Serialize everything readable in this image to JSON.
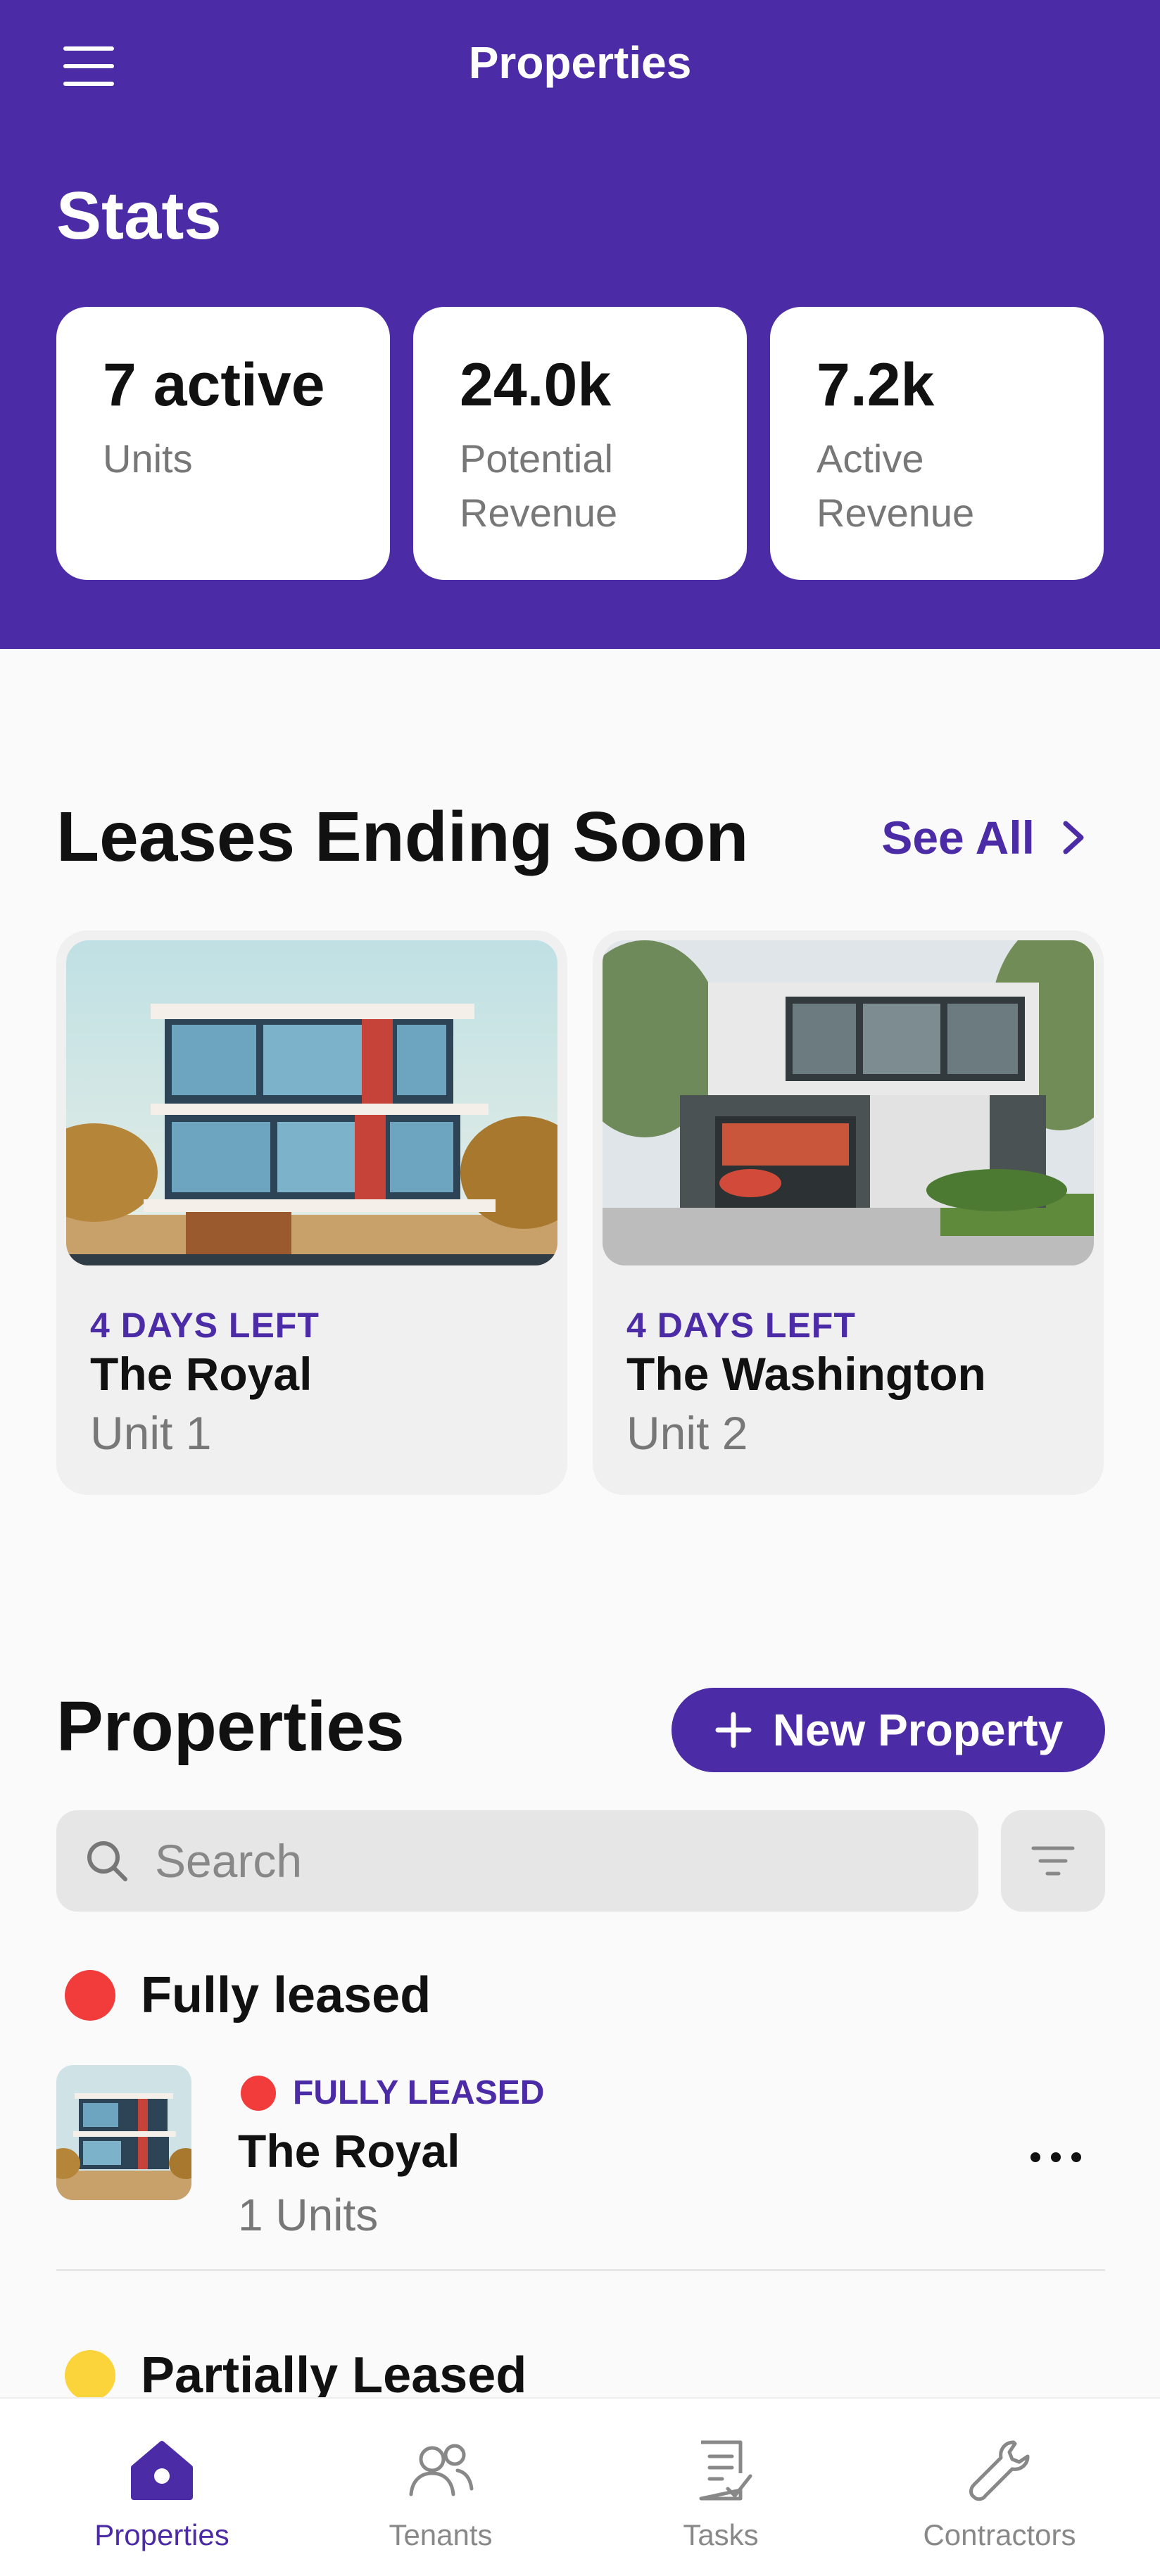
{
  "app": {
    "title": "Properties"
  },
  "stats": {
    "title": "Stats",
    "cards": [
      {
        "value": "7 active",
        "label": "Units"
      },
      {
        "value": "24.0k",
        "label": "Potential Revenue"
      },
      {
        "value": "7.2k",
        "label": "Active Revenue"
      }
    ]
  },
  "leases": {
    "title": "Leases Ending Soon",
    "see_all": "See All",
    "items": [
      {
        "days_left": "4 DAYS LEFT",
        "name": "The Royal",
        "unit": "Unit 1"
      },
      {
        "days_left": "4 DAYS LEFT",
        "name": "The Washington",
        "unit": "Unit 2"
      }
    ]
  },
  "properties": {
    "title": "Properties",
    "new_button": "New Property",
    "search_placeholder": "Search",
    "groups": [
      {
        "name": "Fully leased",
        "color": "#f23b3b"
      },
      {
        "name": "Partially Leased",
        "color": "#fbd43c"
      }
    ],
    "items": [
      {
        "status": "FULLY LEASED",
        "status_color": "#f23b3b",
        "name": "The Royal",
        "units": "1 Units"
      }
    ]
  },
  "tabs": [
    {
      "label": "Properties",
      "icon": "home-icon",
      "active": true
    },
    {
      "label": "Tenants",
      "icon": "people-icon",
      "active": false
    },
    {
      "label": "Tasks",
      "icon": "clipboard-check-icon",
      "active": false
    },
    {
      "label": "Contractors",
      "icon": "wrench-icon",
      "active": false
    }
  ],
  "colors": {
    "accent": "#4c2ba6",
    "background": "#fafafa",
    "card": "#f0f0f0"
  }
}
